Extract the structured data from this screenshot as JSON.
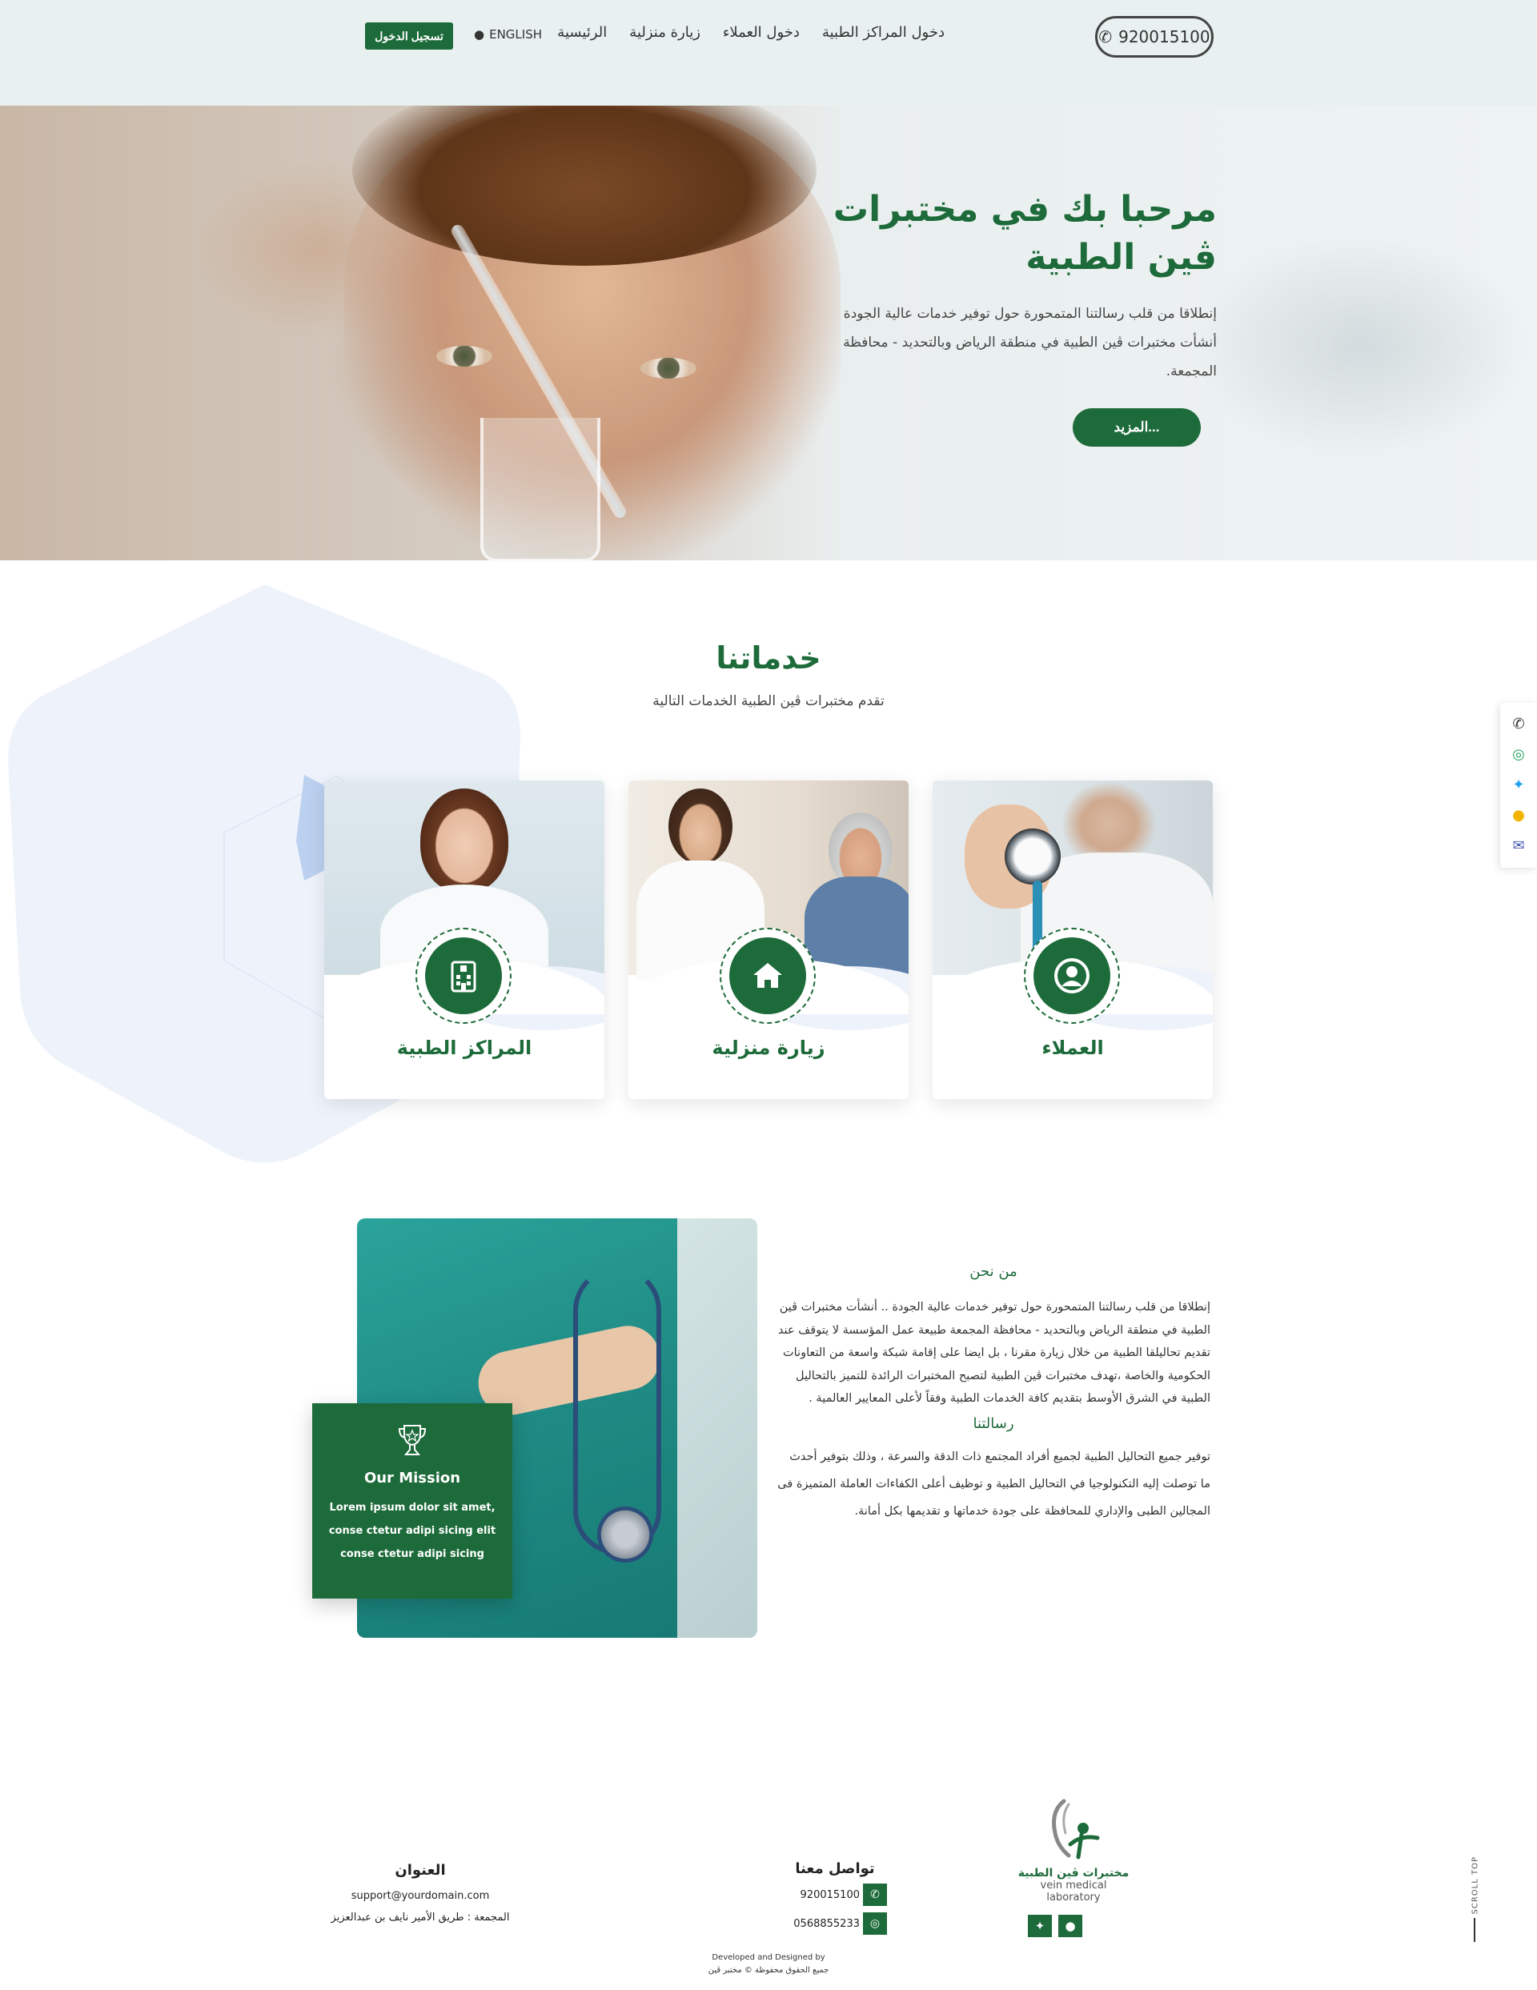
{
  "header": {
    "phone": "920015100",
    "nav": [
      "الرئيسية",
      "زيارة منزلية",
      "دخول العملاء",
      "دخول المراكز الطبية"
    ],
    "lang": "ENGLISH",
    "login": "تسجيل الدخول"
  },
  "hero": {
    "title": "مرحبا بك في مختبرات ڤين الطبية",
    "desc_line1": "إنطلاقا من قلب رسالتنا المتمحورة حول توفير خدمات عالية الجودة",
    "desc_line2": "أنشأت مختبرات ڤين الطبية في منطقة الرياض وبالتحديد - محافظة",
    "desc_line3": "المجمعة.",
    "more": "المزيد..."
  },
  "services": {
    "title": "خدماتنا",
    "subtitle": "تقدم مختبرات ڤين الطبية الخدمات التالية",
    "cards": [
      {
        "title": "المراكز الطبية",
        "icon": "hospital-icon"
      },
      {
        "title": "زيارة منزلية",
        "icon": "home-icon"
      },
      {
        "title": "العملاء",
        "icon": "user-icon"
      }
    ]
  },
  "about": {
    "heading": "من نحن",
    "text": "إنطلاقا من قلب رسالتنا المتمحورة حول توفير خدمات عالية الجودة .. أنشأت مختبرات ڤين الطبية في منطقة الرياض وبالتحديد - محافظة المجمعة طبيعة عمل المؤسسة لا يتوقف عند تقديم تحاليلقا الطبية من خلال زيارة مقرنا ، بل ايضا على إقامة شبكة واسعة من التعاونات الحكومية والخاصة ،تهدف مختبرات ڤين الطبية لتصبح المختبرات الرائدة للتميز بالتحاليل الطبية في الشرق الأوسط بتقديم كافة الخدمات الطبية وفقاً لأعلى المعايير العالمية .",
    "heading2": "رسالتنا",
    "text2": "توفير جميع التحاليل الطبية لجميع أفراد المجتمع ذات الدقة والسرعة ، وذلك بتوفير أحدث ما توصلت إليه التكنولوجيا في التحاليل الطبية و توظيف أعلى الكفاءات العاملة المتميزة فى المجالين الطبى والإداري للمحافظة على جودة خدماتها و تقديمها بكل أمانة."
  },
  "mission": {
    "title": "Our Mission",
    "line1": "Lorem ipsum dolor sit amet,",
    "line2": "conse ctetur adipi sicing elit",
    "line3": "conse ctetur adipi sicing"
  },
  "footer": {
    "logo_name": "مختبرات ڤين الطبية",
    "logo_sub": "vein medical laboratory",
    "contact_title": "تواصل معنا",
    "phone1": "920015100",
    "phone2": "0568855233",
    "address_title": "العنوان",
    "email": "support@yourdomain.com",
    "address": "المجمعة : طريق الأمير نايف بن عبدالعزيز",
    "credit1": "Developed and Designed by",
    "credit2": "جميع الحقوق محفوظة © مختبر ڤين",
    "scroll_top": "SCROLL TOP"
  },
  "colors": {
    "brand": "#1d6b3a",
    "header_bg": "#e8f0f0",
    "wave": "#eef2fb"
  }
}
